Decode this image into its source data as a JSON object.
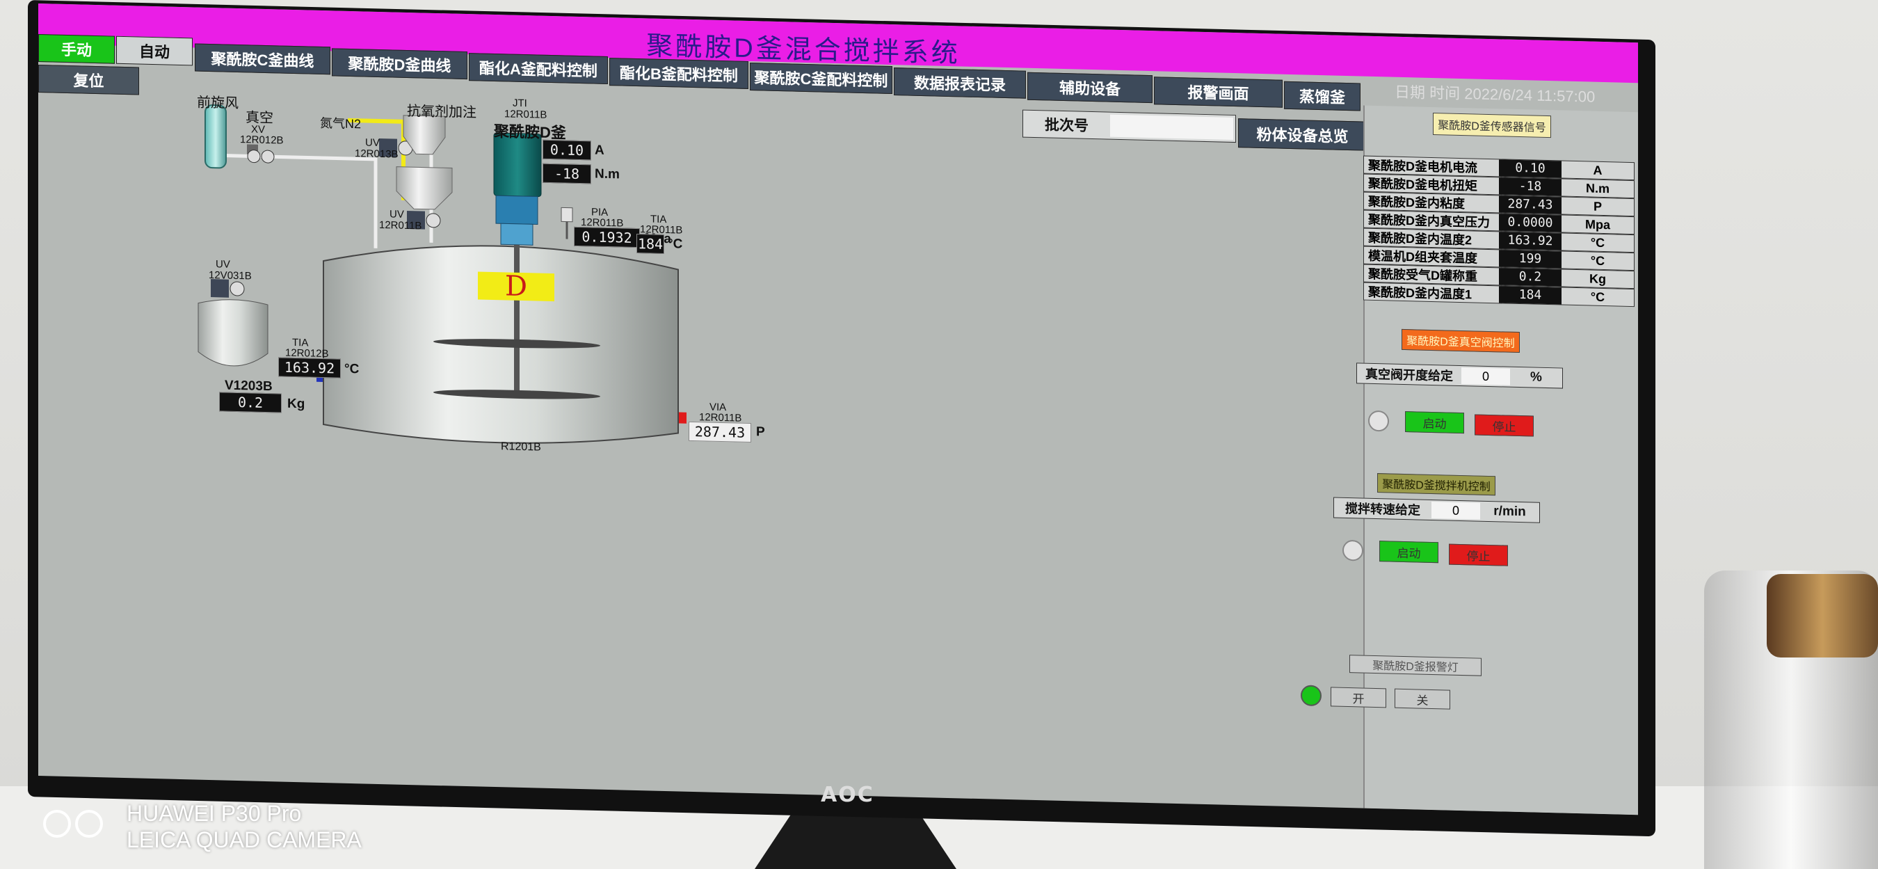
{
  "app": {
    "title": "聚酰胺D釜混合搅拌系统",
    "datetime": "日期 时间  2022/6/24 11:57:00"
  },
  "colors": {
    "titlebar": "#ea1ee6",
    "mode_active": "#19c419",
    "start": "#19c419",
    "stop": "#e01b1b",
    "tank_label": "#f2ec16"
  },
  "mode": {
    "manual": "手动",
    "auto": "自动",
    "reset": "复位"
  },
  "tabs": [
    "聚酰胺C釜曲线",
    "聚酰胺D釜曲线",
    "酯化A釜配料控制",
    "酯化B釜配料控制",
    "聚酰胺C釜配料控制",
    "数据报表记录",
    "辅助设备",
    "报警画面",
    "蒸馏釜"
  ],
  "batch": {
    "label": "批次号",
    "value": "",
    "overview_button": "粉体设备总览"
  },
  "sensor_button": "聚酰胺D釜传感器信号",
  "sensor_table": [
    {
      "name": "聚酰胺D釜电机电流",
      "value": "0.10",
      "unit": "A"
    },
    {
      "name": "聚酰胺D釜电机扭矩",
      "value": "-18",
      "unit": "N.m"
    },
    {
      "name": "聚酰胺D釜内粘度",
      "value": "287.43",
      "unit": "P"
    },
    {
      "name": "聚酰胺D釜内真空压力",
      "value": "0.0000",
      "unit": "Mpa"
    },
    {
      "name": "聚酰胺D釜内温度2",
      "value": "163.92",
      "unit": "°C"
    },
    {
      "name": "模温机D组夹套温度",
      "value": "199",
      "unit": "°C"
    },
    {
      "name": "聚酰胺受气D罐称重",
      "value": "0.2",
      "unit": "Kg"
    },
    {
      "name": "聚酰胺D釜内温度1",
      "value": "184",
      "unit": "°C"
    }
  ],
  "vacuum_control": {
    "title": "聚酰胺D釜真空阀控制",
    "setpoint_label": "真空阀开度给定",
    "setpoint_value": "0",
    "unit": "%",
    "start": "启动",
    "stop": "停止"
  },
  "agitator_control": {
    "title": "聚酰胺D釜搅拌机控制",
    "setpoint_label": "搅拌转速给定",
    "setpoint_value": "0",
    "unit": "r/min",
    "start": "启动",
    "stop": "停止"
  },
  "indicator": {
    "title": "聚酰胺D釜报警灯",
    "on": "开",
    "off": "关"
  },
  "process": {
    "fan": "前旋风",
    "vacuum": "真空",
    "xv": "XV",
    "xv_tag": "12R012B",
    "antioxidant": "抗氧剂加注",
    "nitrogen": "氮气N2",
    "uv1": "UV",
    "uv1_tag": "12R013B",
    "uv2": "UV",
    "uv2_tag": "12R011B",
    "uv3": "UV",
    "uv3_tag": "12V031B",
    "jti": "JTI",
    "jti_tag": "12R011B",
    "reactor_name": "聚酰胺D釜",
    "motor_current": "0.10",
    "motor_current_unit": "A",
    "motor_torque": "-18",
    "motor_torque_unit": "N.m",
    "pia": "PIA",
    "pia_tag": "12R011B",
    "pressure": "0.1932",
    "pressure_unit": "Mpa",
    "tia1": "TIA",
    "tia1_tag": "12R011B",
    "temp1": "184",
    "temp1_unit": "°C",
    "tia2": "TIA",
    "tia2_tag": "12R012B",
    "temp2": "163.92",
    "temp2_unit": "°C",
    "tank_letter": "D",
    "reactor_tag": "R1201B",
    "small_tank": "V1203B",
    "weight": "0.2",
    "weight_unit": "Kg",
    "via": "VIA",
    "via_tag": "12R011B",
    "viscosity": "287.43",
    "viscosity_unit": "P"
  },
  "photo": {
    "brand": "AOC",
    "watermark_1": "HUAWEI P30 Pro",
    "watermark_2": "LEICA QUAD CAMERA"
  }
}
